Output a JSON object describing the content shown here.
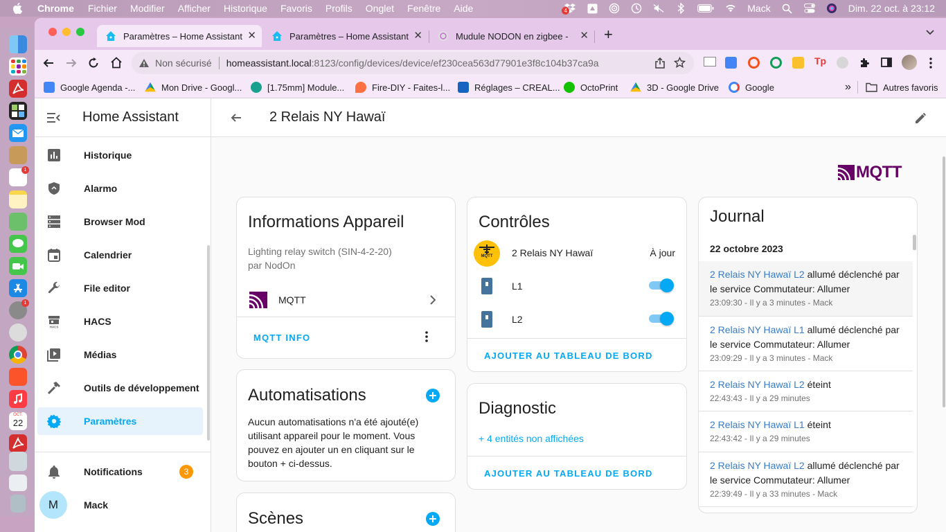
{
  "menubar": {
    "app": "Chrome",
    "items": [
      "Fichier",
      "Modifier",
      "Afficher",
      "Historique",
      "Favoris",
      "Profils",
      "Onglet",
      "Fenêtre",
      "Aide"
    ],
    "dropbox_badge": "4",
    "user": "Mack",
    "datetime": "Dim. 22 oct. à  23:12"
  },
  "dock": {
    "calendar_month": "OCT.",
    "calendar_day": "22",
    "badge": "1"
  },
  "browser": {
    "tabs": [
      {
        "title": "Paramètres – Home Assistant"
      },
      {
        "title": "Paramètres – Home Assistant"
      },
      {
        "title": "Mudule NODON en zigbee - E"
      }
    ],
    "security": "Non sécurisé",
    "url_host": "homeassistant.local",
    "url_rest": ":8123/config/devices/device/ef230cea563d77901e3f8c104b37ca9a",
    "bookmarks": [
      "Google Agenda -...",
      "Mon Drive - Googl...",
      "[1.75mm] Module...",
      "Fire-DIY - Faites-l...",
      "Réglages – CREAL...",
      "OctoPrint",
      "3D - Google Drive",
      "Google"
    ],
    "more_bookmarks": "»",
    "other_favorites": "Autres favoris"
  },
  "sidebar": {
    "title": "Home Assistant",
    "items": [
      {
        "label": "Historique",
        "icon": "chart-icon"
      },
      {
        "label": "Alarmo",
        "icon": "shield-icon"
      },
      {
        "label": "Browser Mod",
        "icon": "server-icon"
      },
      {
        "label": "Calendrier",
        "icon": "calendar-icon"
      },
      {
        "label": "File editor",
        "icon": "wrench-icon"
      },
      {
        "label": "HACS",
        "icon": "hacs-icon"
      },
      {
        "label": "Médias",
        "icon": "media-icon"
      },
      {
        "label": "Outils de développement",
        "icon": "hammer-icon"
      },
      {
        "label": "Paramètres",
        "icon": "gear-icon"
      }
    ],
    "notifications": {
      "label": "Notifications",
      "count": "3"
    },
    "user": {
      "initial": "M",
      "name": "Mack"
    }
  },
  "page": {
    "title": "2 Relais NY Hawaï",
    "integration_logo": "MQTT"
  },
  "info_card": {
    "title": "Informations Appareil",
    "model": "Lighting relay switch (SIN-4-2-20)",
    "by": "par NodOn",
    "integration": "MQTT",
    "action": "MQTT INFO"
  },
  "automations_card": {
    "title": "Automatisations",
    "text": "Aucun automatisations n'a été ajouté(e) utilisant appareil pour le moment. Vous pouvez en ajouter un en cliquant sur le bouton + ci-dessus."
  },
  "scenes_card": {
    "title": "Scènes"
  },
  "controls_card": {
    "title": "Contrôles",
    "update": {
      "name": "2 Relais NY Hawaï",
      "state": "À jour",
      "icon_text": "MQTT"
    },
    "switches": [
      {
        "name": "L1",
        "on": true
      },
      {
        "name": "L2",
        "on": true
      }
    ],
    "action": "AJOUTER AU TABLEAU DE BORD"
  },
  "diagnostic_card": {
    "title": "Diagnostic",
    "hidden": "+ 4 entités non affichées",
    "action": "AJOUTER AU TABLEAU DE BORD"
  },
  "journal": {
    "title": "Journal",
    "date": "22 octobre 2023",
    "entries": [
      {
        "entity": "2 Relais NY Hawaï L2",
        "text": "allumé déclenché par le service Commutateur: Allumer",
        "meta": "23:09:30 - Il y a 3 minutes - Mack"
      },
      {
        "entity": "2 Relais NY Hawaï L1",
        "text": "allumé déclenché par le service Commutateur: Allumer",
        "meta": "23:09:29 - Il y a 3 minutes - Mack"
      },
      {
        "entity": "2 Relais NY Hawaï L2",
        "text": "éteint",
        "meta": "22:43:43 - Il y a 29 minutes"
      },
      {
        "entity": "2 Relais NY Hawaï L1",
        "text": "éteint",
        "meta": "22:43:42 - Il y a 29 minutes"
      },
      {
        "entity": "2 Relais NY Hawaï L2",
        "text": "allumé déclenché par le service Commutateur: Allumer",
        "meta": "22:39:49 - Il y a 33 minutes - Mack"
      }
    ]
  },
  "colors": {
    "primary": "#03a9f4",
    "mqtt": "#660066",
    "badge": "#ff9800",
    "selected_bg": "#e6f3fd"
  }
}
